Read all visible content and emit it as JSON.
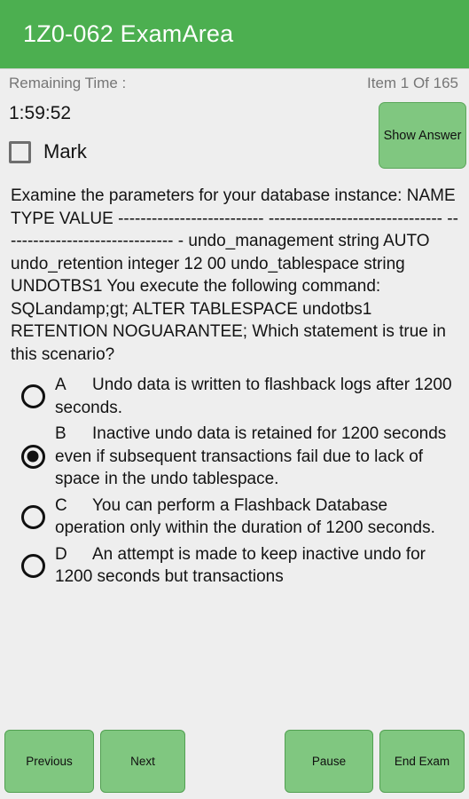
{
  "colors": {
    "appbar_green": "#4caf50",
    "button_green": "#80c780",
    "page_background": "#eeeeee",
    "muted_text": "#767676"
  },
  "appbar": {
    "title": "1Z0-062 ExamArea"
  },
  "status": {
    "remaining_time_label": "Remaining Time :",
    "item_counter": "Item 1 Of 165"
  },
  "timer": {
    "value": "1:59:52"
  },
  "mark": {
    "label": "Mark",
    "checked": false
  },
  "show_answer": {
    "label": "Show Answer"
  },
  "question": {
    "text": "Examine the parameters for your database instance: NAME TYPE VALUE -------------------------- ------------------------------- ------------------------------- - undo_management string AUTO undo_retention integer 12 00 undo_tablespace string UNDOTBS1 You execute the following command: SQLandamp;gt; ALTER TABLESPACE undotbs1 RETENTION NOGUARANTEE; Which statement is true in this scenario?"
  },
  "options": [
    {
      "letter": "A",
      "text": "Undo data is written to flashback logs after 1200 seconds.",
      "selected": false
    },
    {
      "letter": "B",
      "text": "Inactive undo data is retained for 1200 seconds even if subsequent transactions fail due to lack of space in the undo tablespace.",
      "selected": true
    },
    {
      "letter": "C",
      "text": "You can perform a Flashback Database operation only within the duration of 1200 seconds.",
      "selected": false
    },
    {
      "letter": "D",
      "text": "An attempt is made to keep inactive undo for 1200 seconds but transactions",
      "selected": false
    }
  ],
  "nav": {
    "previous_label": "Previous",
    "next_label": "Next",
    "pause_label": "Pause",
    "end_exam_label": "End Exam"
  }
}
